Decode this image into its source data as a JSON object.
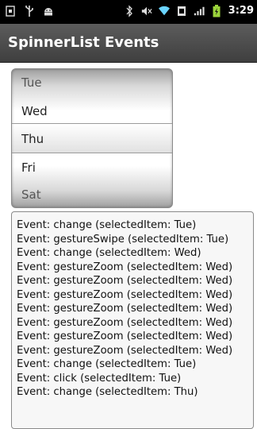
{
  "status_bar": {
    "icons": [
      "sim-icon",
      "usb-icon",
      "android-debug-icon",
      "bluetooth-icon",
      "mute-icon",
      "wifi-icon",
      "data-icon",
      "signal-icon",
      "battery-icon"
    ],
    "time": "3:29"
  },
  "titlebar": {
    "title": "SpinnerList Events"
  },
  "spinner": {
    "items": [
      "Tue",
      "Wed",
      "Thu",
      "Fri",
      "Sat"
    ],
    "selected": "Thu"
  },
  "event_log": {
    "lines": [
      "Event: change (selectedItem: Tue)",
      "Event: gestureSwipe (selectedItem: Tue)",
      "Event: change (selectedItem: Wed)",
      "Event: gestureZoom (selectedItem: Wed)",
      "Event: gestureZoom (selectedItem: Wed)",
      "Event: gestureZoom (selectedItem: Wed)",
      "Event: gestureZoom (selectedItem: Wed)",
      "Event: gestureZoom (selectedItem: Wed)",
      "Event: gestureZoom (selectedItem: Wed)",
      "Event: gestureZoom (selectedItem: Wed)",
      "Event: change (selectedItem: Tue)",
      "Event: click (selectedItem: Tue)",
      "Event: change (selectedItem: Thu)"
    ]
  }
}
